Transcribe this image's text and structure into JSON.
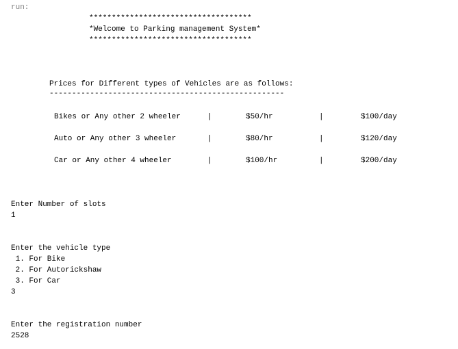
{
  "console": {
    "run_label": "run:",
    "banner_top": "************************************",
    "banner_title": "*Welcome to Parking management System*",
    "banner_bottom": "************************************",
    "prices_heading": "Prices for Different types of Vehicles are as follows:",
    "prices_rule": "----------------------------------------------------",
    "price_rows": [
      {
        "vehicle": "Bikes or Any other 2 wheeler",
        "sep1": "|",
        "hourly": "$50/hr",
        "sep2": "|",
        "daily": "$100/day"
      },
      {
        "vehicle": "Auto or Any other 3 wheeler",
        "sep1": "|",
        "hourly": "$80/hr",
        "sep2": "|",
        "daily": "$120/day"
      },
      {
        "vehicle": "Car or Any other 4 wheeler",
        "sep1": "|",
        "hourly": "$100/hr",
        "sep2": "|",
        "daily": "$200/day"
      }
    ],
    "slots_prompt": "Enter Number of slots",
    "slots_input": "1",
    "vehicle_type_prompt": "Enter the vehicle type",
    "vehicle_options": [
      " 1. For Bike",
      " 2. For Autorickshaw",
      " 3. For Car"
    ],
    "vehicle_type_input": "3",
    "registration_prompt": "Enter the registration number",
    "registration_input": "2528"
  }
}
